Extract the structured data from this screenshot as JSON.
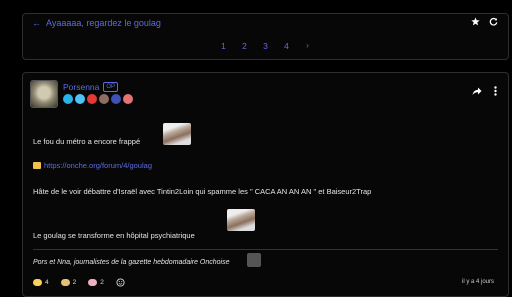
{
  "topic": {
    "back_label": "Ayaaaaa, regardez le goulag",
    "pages": [
      "1",
      "2",
      "3",
      "4"
    ],
    "next_label": "›"
  },
  "post": {
    "author": "Porsenna",
    "op_badge": "OP",
    "badge_colors": [
      "#2ab3e8",
      "#4fc3f7",
      "#e53935",
      "#8d6e63",
      "#3f51b5",
      "#e57373"
    ],
    "lines": {
      "line1": "Le fou du métro a encore frappé",
      "link": "https://onche.org/forum/4/goulag",
      "line3": "Hâte de le voir débattre d'Israël avec Tintin2Loin qui spamme les \" CACA AN AN AN \" et Baiseur2Trap",
      "line4": "Le goulag se transforme en hôpital psychiatrique"
    },
    "signature": "Pors et Nna, journalistes de la gazette hebdomadaire Onchoise",
    "footer": {
      "reactions_1": "4",
      "reactions_2": "2",
      "reactions_3": "2"
    },
    "time": "il y a 4 jours"
  },
  "colors": {
    "accent": "#5c6ce0",
    "background": "#000000"
  }
}
